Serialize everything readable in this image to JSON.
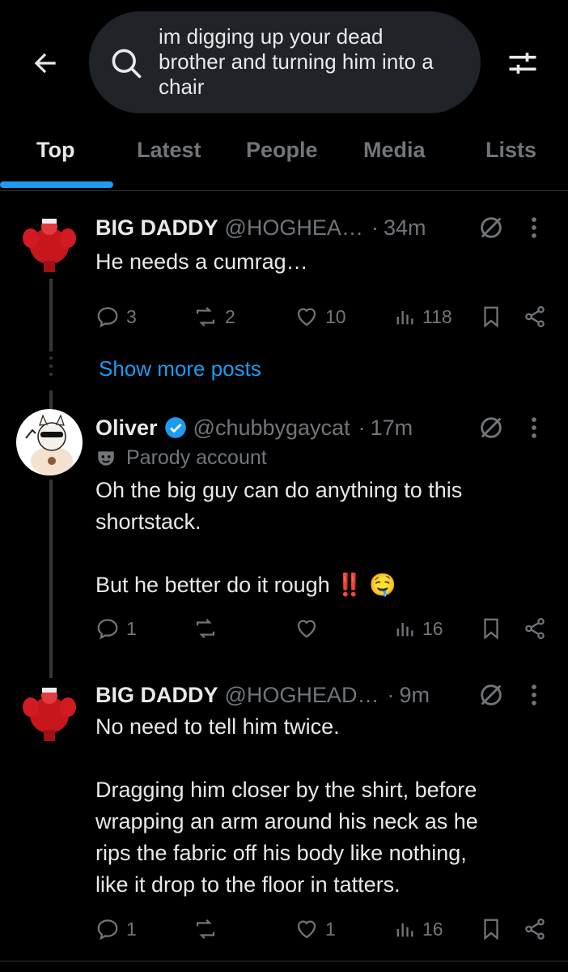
{
  "search": {
    "query": "im digging up your dead\nbrother and turning him into a\nchair"
  },
  "tabs": [
    {
      "label": "Top"
    },
    {
      "label": "Latest"
    },
    {
      "label": "People"
    },
    {
      "label": "Media"
    },
    {
      "label": "Lists"
    }
  ],
  "posts": [
    {
      "name": "BIG DADDY",
      "handle": "@HOGHEA…",
      "time": "34m",
      "text": "He needs a cumrag…",
      "replies": "3",
      "reposts": "2",
      "likes": "10",
      "views": "118"
    },
    {
      "name": "Oliver",
      "handle": "@chubbygaycat",
      "time": "17m",
      "badge": "Parody account",
      "text": "Oh the big guy can do anything to this\nshortstack.\n\nBut he better do it rough ‼️ 🤤",
      "replies": "1",
      "reposts": "",
      "likes": "",
      "views": "16"
    },
    {
      "name": "BIG DADDY",
      "handle": "@HOGHEAD…",
      "time": "9m",
      "text": "No need to tell him twice.\n\nDragging him closer by the shirt, before\nwrapping an arm around his neck as he\nrips the fabric off his body like nothing,\nlike it drop to the floor in tatters.",
      "replies": "1",
      "reposts": "",
      "likes": "1",
      "views": "16"
    }
  ],
  "show_more": "Show more posts",
  "colors": {
    "background": "#000000",
    "accent": "#1d9bf0",
    "muted": "#71767b",
    "text": "#e7e9ea"
  }
}
